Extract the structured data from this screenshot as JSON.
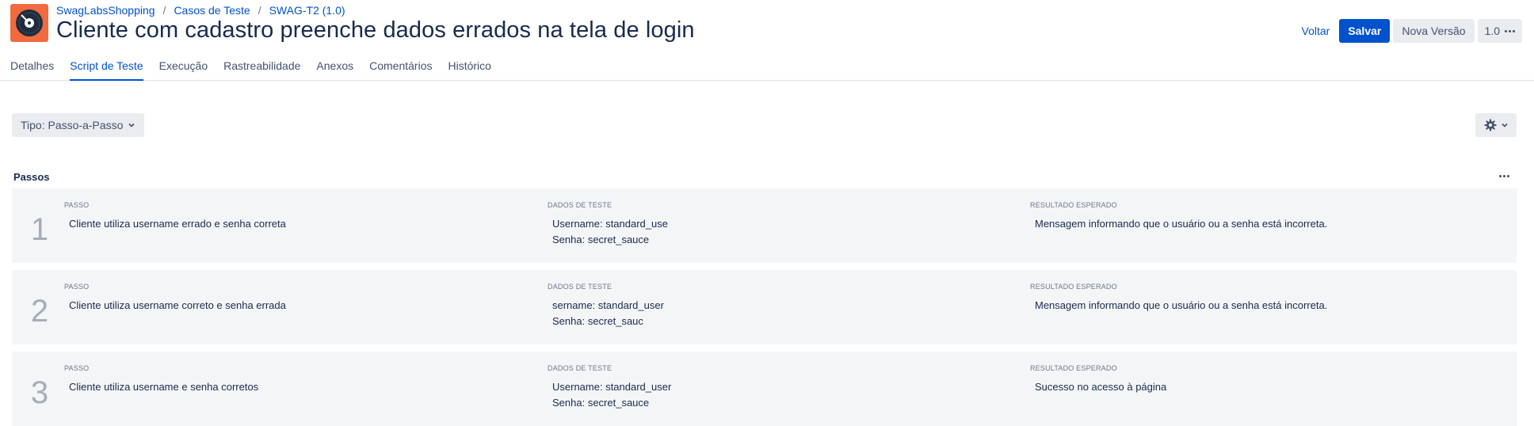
{
  "breadcrumb": [
    "SwagLabsShopping",
    "Casos de Teste",
    "SWAG-T2 (1.0)"
  ],
  "title": "Cliente com cadastro preenche dados errados na tela de login",
  "actions": {
    "back": "Voltar",
    "save": "Salvar",
    "new_version": "Nova Versão",
    "version": "1.0"
  },
  "tabs": [
    "Detalhes",
    "Script de Teste",
    "Execução",
    "Rastreabilidade",
    "Anexos",
    "Comentários",
    "Histórico"
  ],
  "active_tab": "Script de Teste",
  "type_select": "Tipo: Passo-a-Passo",
  "steps_title": "Passos",
  "column_labels": {
    "step": "PASSO",
    "data": "DADOS DE TESTE",
    "expected": "RESULTADO ESPERADO"
  },
  "steps": [
    {
      "number": "1",
      "step": "Cliente utiliza username errado e senha correta",
      "data": "Username: standard_use\nSenha: secret_sauce",
      "expected": "Mensagem informando que o usuário ou a senha está incorreta."
    },
    {
      "number": "2",
      "step": "Cliente utiliza username correto e senha errada",
      "data": "sername: standard_user\nSenha: secret_sauc",
      "expected": "Mensagem informando que o usuário ou a senha está incorreta."
    },
    {
      "number": "3",
      "step": "Cliente utiliza username e senha corretos",
      "data": "Username: standard_user\nSenha: secret_sauce",
      "expected": "Sucesso no acesso à página"
    }
  ],
  "colors": {
    "primary": "#0052cc",
    "logo_bg": "#f26a3f",
    "step_bg": "#f4f5f7"
  },
  "icons": {
    "logo": "vinyl-record-icon",
    "settings": "gear-icon",
    "dropdown": "chevron-down-icon",
    "more": "ellipsis-icon"
  }
}
